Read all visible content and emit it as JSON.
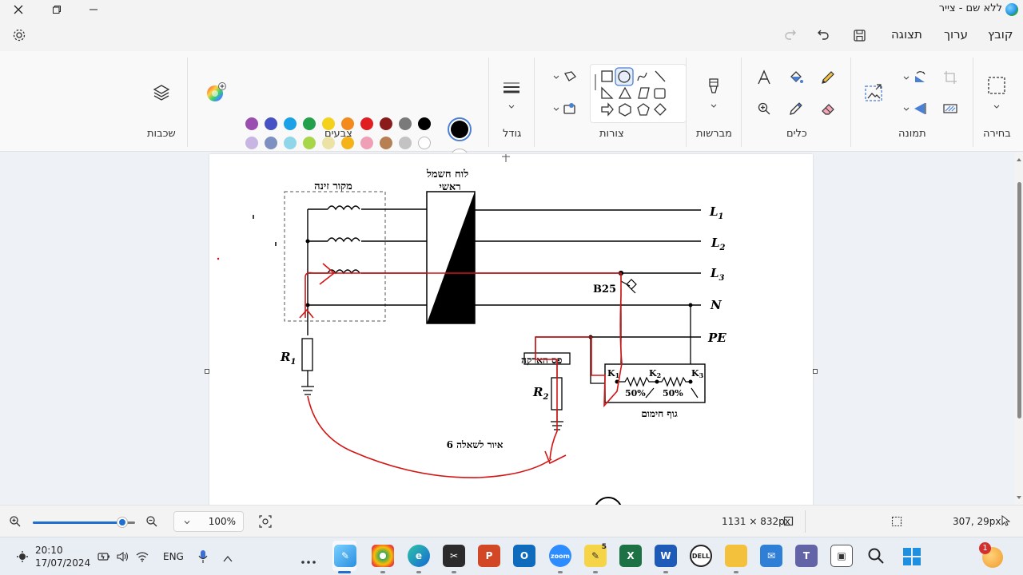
{
  "window": {
    "title": "ללא שם - צייר"
  },
  "menu": {
    "file": "קובץ",
    "edit": "ערוך",
    "view": "תצוגה"
  },
  "ribbon": {
    "groups": {
      "selection": "בחירה",
      "image": "תמונה",
      "tools": "כלים",
      "brushes": "מברשות",
      "shapes": "צורות",
      "size": "גודל",
      "colors": "צבעים",
      "layers": "שכבות"
    },
    "palette": {
      "row1": [
        "#9a4fb0",
        "#4651c4",
        "#1aa1e6",
        "#22a04b",
        "#f4d11b",
        "#f28a1d",
        "#e02020",
        "#8b1a1a",
        "#7a7a7a",
        "#000000"
      ],
      "row2": [
        "#c7b6e3",
        "#7e8fc2",
        "#90d6ea",
        "#a8d64a",
        "#ece2a6",
        "#f5b31a",
        "#f0a0b6",
        "#b78053",
        "#c3c3c3",
        "#ffffff"
      ]
    },
    "primary_color": "#000000",
    "secondary_color": "#ffffff"
  },
  "diagram": {
    "source_label": "מקור זינה",
    "panel_label_1": "לוח חשמל",
    "panel_label_2": "ראשי",
    "l1": "L",
    "l1_sub": "1",
    "l2": "L",
    "l2_sub": "2",
    "l3": "L",
    "l3_sub": "3",
    "n": "N",
    "pe": "PE",
    "b25": "B25",
    "r1": "R",
    "r1_sub": "1",
    "r2": "R",
    "r2_sub": "2",
    "earth_bar": "פס הארקה",
    "k1": "K",
    "k1_sub": "1",
    "k2": "K",
    "k2_sub": "2",
    "k3": "K",
    "k3_sub": "3",
    "pct_left": "50%",
    "pct_right": "50%",
    "heater": "גוף חימום",
    "caption": "איור לשאלה 6"
  },
  "status": {
    "zoom": "100%",
    "canvas_size": "1131 × 832px",
    "cursor_pos": "307, 29px"
  },
  "taskbar": {
    "time": "20:10",
    "date": "17/07/2024",
    "lang": "ENG",
    "badge_count": "1",
    "onenote_badge": "5"
  }
}
